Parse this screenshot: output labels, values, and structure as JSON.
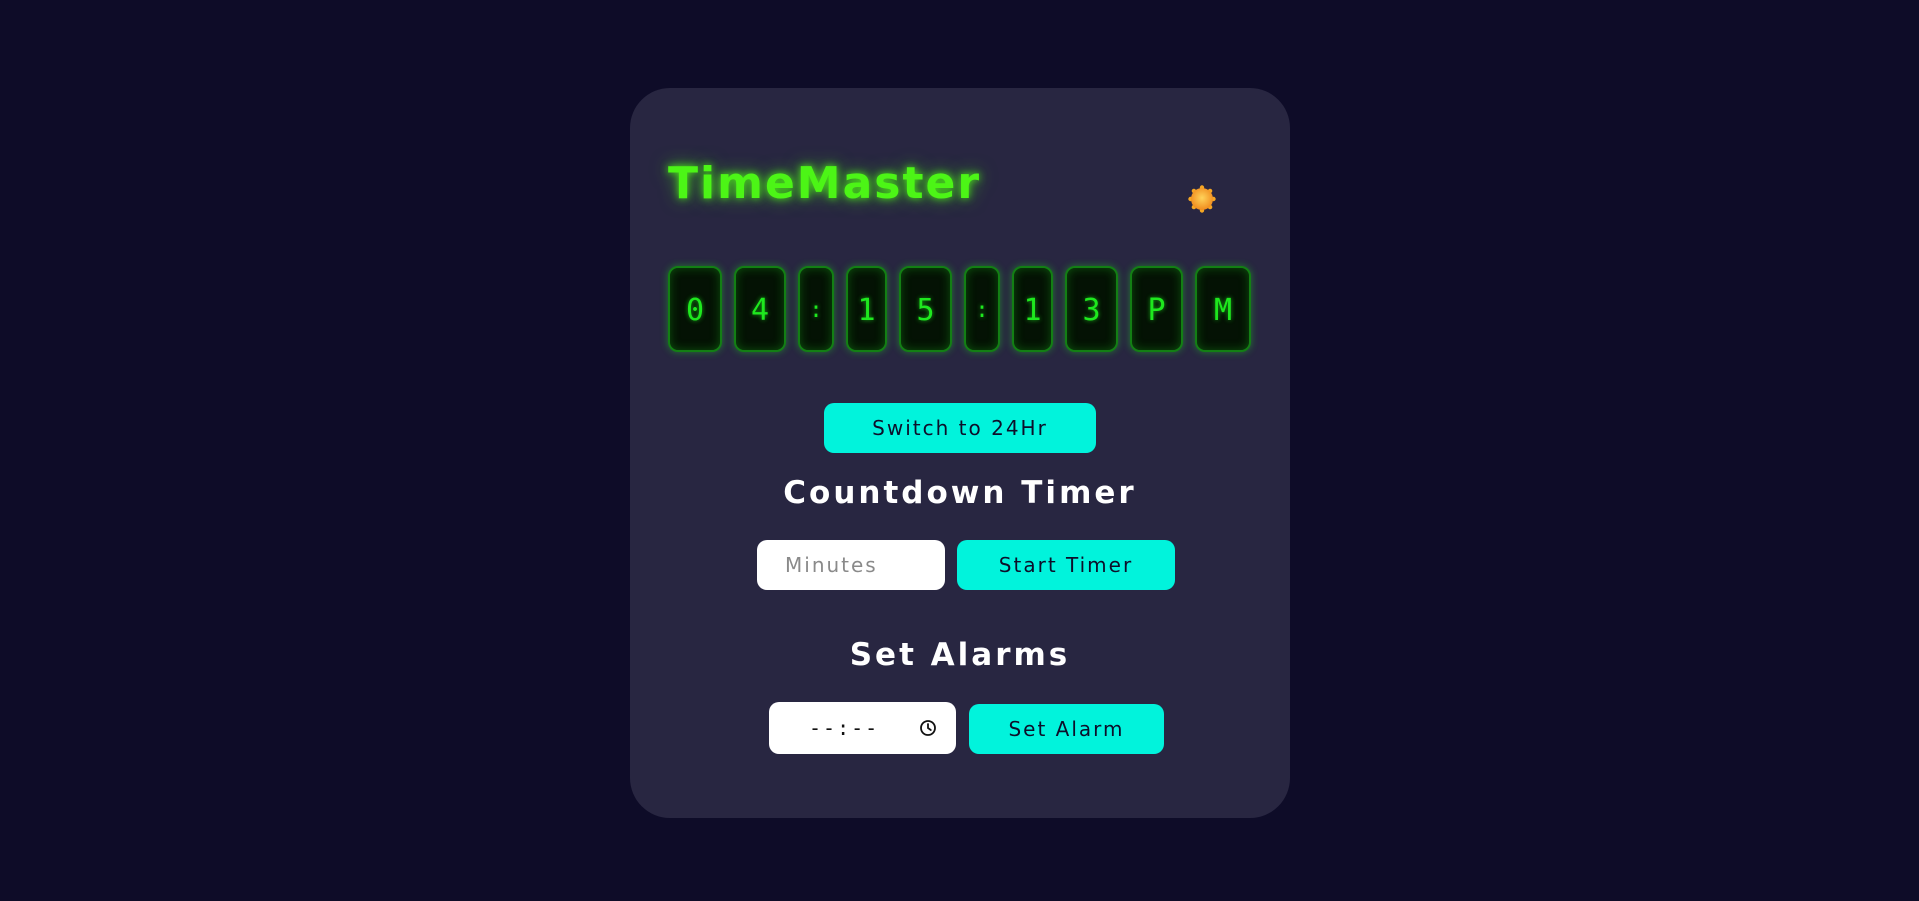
{
  "app": {
    "title": "TimeMaster"
  },
  "clock": {
    "characters": [
      "0",
      "4",
      ":",
      "1",
      "5",
      ":",
      "1",
      "3",
      "P",
      "M"
    ],
    "digit_color": "#1ee81e"
  },
  "format_toggle": {
    "label": "Switch to 24Hr"
  },
  "countdown": {
    "title": "Countdown Timer",
    "minutes_placeholder": "Minutes",
    "start_label": "Start Timer"
  },
  "alarms": {
    "title": "Set Alarms",
    "time_value": "--:--",
    "set_label": "Set Alarm"
  },
  "icons": {
    "theme_toggle": "sun-icon",
    "time_picker": "clock-icon"
  },
  "colors": {
    "background": "#0e0c28",
    "card": "#282641",
    "accent": "#01f3dc",
    "title_glow": "#4cf516",
    "sun": "#f5a623"
  }
}
